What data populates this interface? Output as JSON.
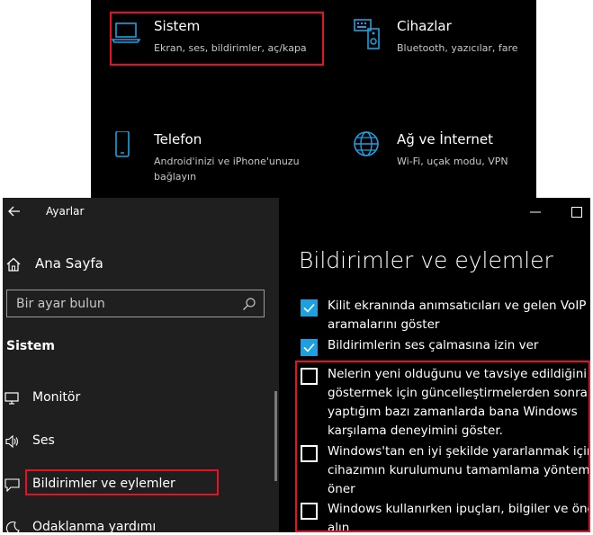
{
  "settings_grid": {
    "tiles": [
      {
        "title": "Sistem",
        "desc": "Ekran, ses, bildirimler, aç/kapa",
        "icon": "laptop-icon"
      },
      {
        "title": "Cihazlar",
        "desc": "Bluetooth, yazıcılar, fare",
        "icon": "devices-icon"
      },
      {
        "title": "Telefon",
        "desc_lines": [
          "Android'inizi ve iPhone'unuzu",
          "bağlayın"
        ],
        "icon": "phone-icon"
      },
      {
        "title": "Ağ ve İnternet",
        "desc": "Wi-Fi, uçak modu, VPN",
        "icon": "globe-icon"
      }
    ]
  },
  "window": {
    "app_title": "Ayarlar",
    "sidebar": {
      "home_label": "Ana Sayfa",
      "search_placeholder": "Bir ayar bulun",
      "section": "Sistem",
      "items": [
        {
          "label": "Monitör",
          "icon": "monitor-icon"
        },
        {
          "label": "Ses",
          "icon": "speaker-icon"
        },
        {
          "label": "Bildirimler ve eylemler",
          "icon": "notification-icon"
        },
        {
          "label": "Odaklanma yardımı",
          "icon": "moon-icon"
        }
      ]
    },
    "main": {
      "page_title": "Bildirimler ve eylemler",
      "options": [
        {
          "lines": [
            "Kilit ekranında anımsatıcıları ve gelen VoIP",
            "aramalarını göster"
          ],
          "checked": true
        },
        {
          "lines": [
            "Bildirimlerin ses çalmasına izin ver"
          ],
          "checked": true
        },
        {
          "lines": [
            "Nelerin yeni olduğunu ve tavsiye edildiğini",
            "göstermek için güncelleştirmelerden sonra ve",
            "yaptığım bazı zamanlarda bana Windows",
            "karşılama deneyimini göster."
          ],
          "checked": false
        },
        {
          "lines": [
            "Windows'tan en iyi şekilde yararlanmak için",
            "cihazımın kurulumunu tamamlama yöntemle",
            "öner"
          ],
          "checked": false
        },
        {
          "lines": [
            "Windows kullanırken ipuçları, bilgiler ve öner",
            "alın"
          ],
          "checked": false
        }
      ]
    }
  },
  "colors": {
    "accent": "#1ba1e2",
    "highlight": "#e81123",
    "sidebar_bg": "#1f1f1f",
    "main_bg": "#000000"
  }
}
